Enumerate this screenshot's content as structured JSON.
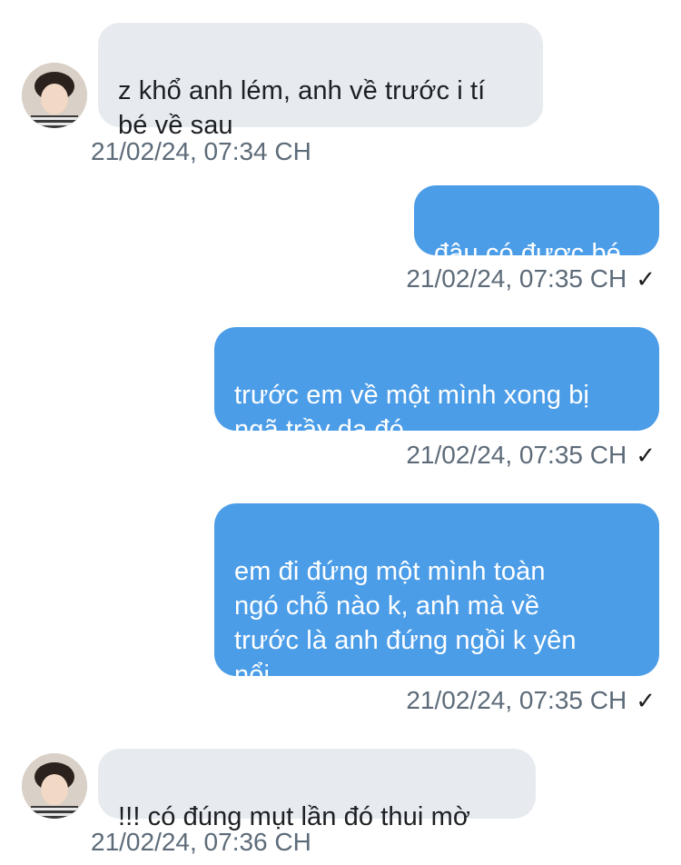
{
  "conversation": {
    "messages": [
      {
        "direction": "incoming",
        "text": "z khổ anh lém, anh về trước i tí\nbé về sau",
        "timestamp": "21/02/24, 07:34 CH"
      },
      {
        "direction": "outgoing",
        "text": "đâu có được bé",
        "timestamp": "21/02/24, 07:35 CH",
        "status_icon": "checkmark-icon",
        "status_glyph": "✓"
      },
      {
        "direction": "outgoing",
        "text": "trước em về một mình xong bị\nngã trầy da đó",
        "timestamp": "21/02/24, 07:35 CH",
        "status_icon": "checkmark-icon",
        "status_glyph": "✓"
      },
      {
        "direction": "outgoing",
        "text": "em đi đứng một mình toàn\nngó chỗ nào k, anh mà về\ntrước là anh đứng ngồi k yên\nnổi",
        "timestamp": "21/02/24, 07:35 CH",
        "status_icon": "checkmark-icon",
        "status_glyph": "✓"
      },
      {
        "direction": "incoming",
        "text": "!!! có đúng mụt lần đó thui mờ",
        "timestamp": "21/02/24, 07:36 CH"
      }
    ]
  },
  "colors": {
    "incoming_bubble": "#e7ebef",
    "outgoing_bubble": "#4c9de8",
    "timestamp_text": "#5d6b79"
  },
  "icons": {
    "avatar": "user-avatar-photo",
    "read_receipt": "checkmark-icon"
  }
}
